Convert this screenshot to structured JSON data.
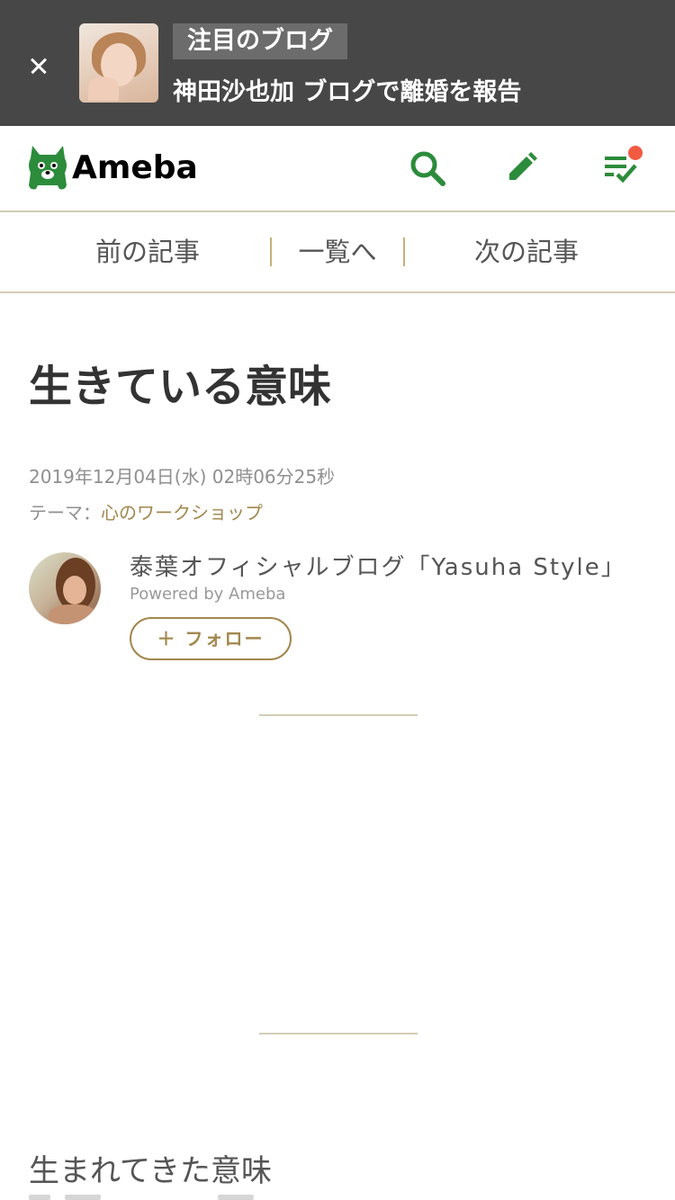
{
  "banner": {
    "tag": "注目のブログ",
    "headline": "神田沙也加 ブログで離婚を報告"
  },
  "header": {
    "logo_text": "Ameba",
    "brand_color": "#2c8c3b",
    "notification_color": "#f15b41",
    "icons": [
      "search-icon",
      "pencil-icon",
      "reading-list-icon"
    ]
  },
  "article_nav": {
    "prev": "前の記事",
    "list": "一覧へ",
    "next": "次の記事"
  },
  "article": {
    "title": "生きている意味",
    "date": "2019年12月04日(水) 02時06分25秒",
    "theme_label": "テーマ：",
    "theme_link": "心のワークショップ",
    "subheading": "生まれてきた意味"
  },
  "author": {
    "blog_name": "泰葉オフィシャルブログ「Yasuha Style」",
    "powered_by": "Powered by Ameba",
    "follow_label": "＋ フォロー"
  }
}
